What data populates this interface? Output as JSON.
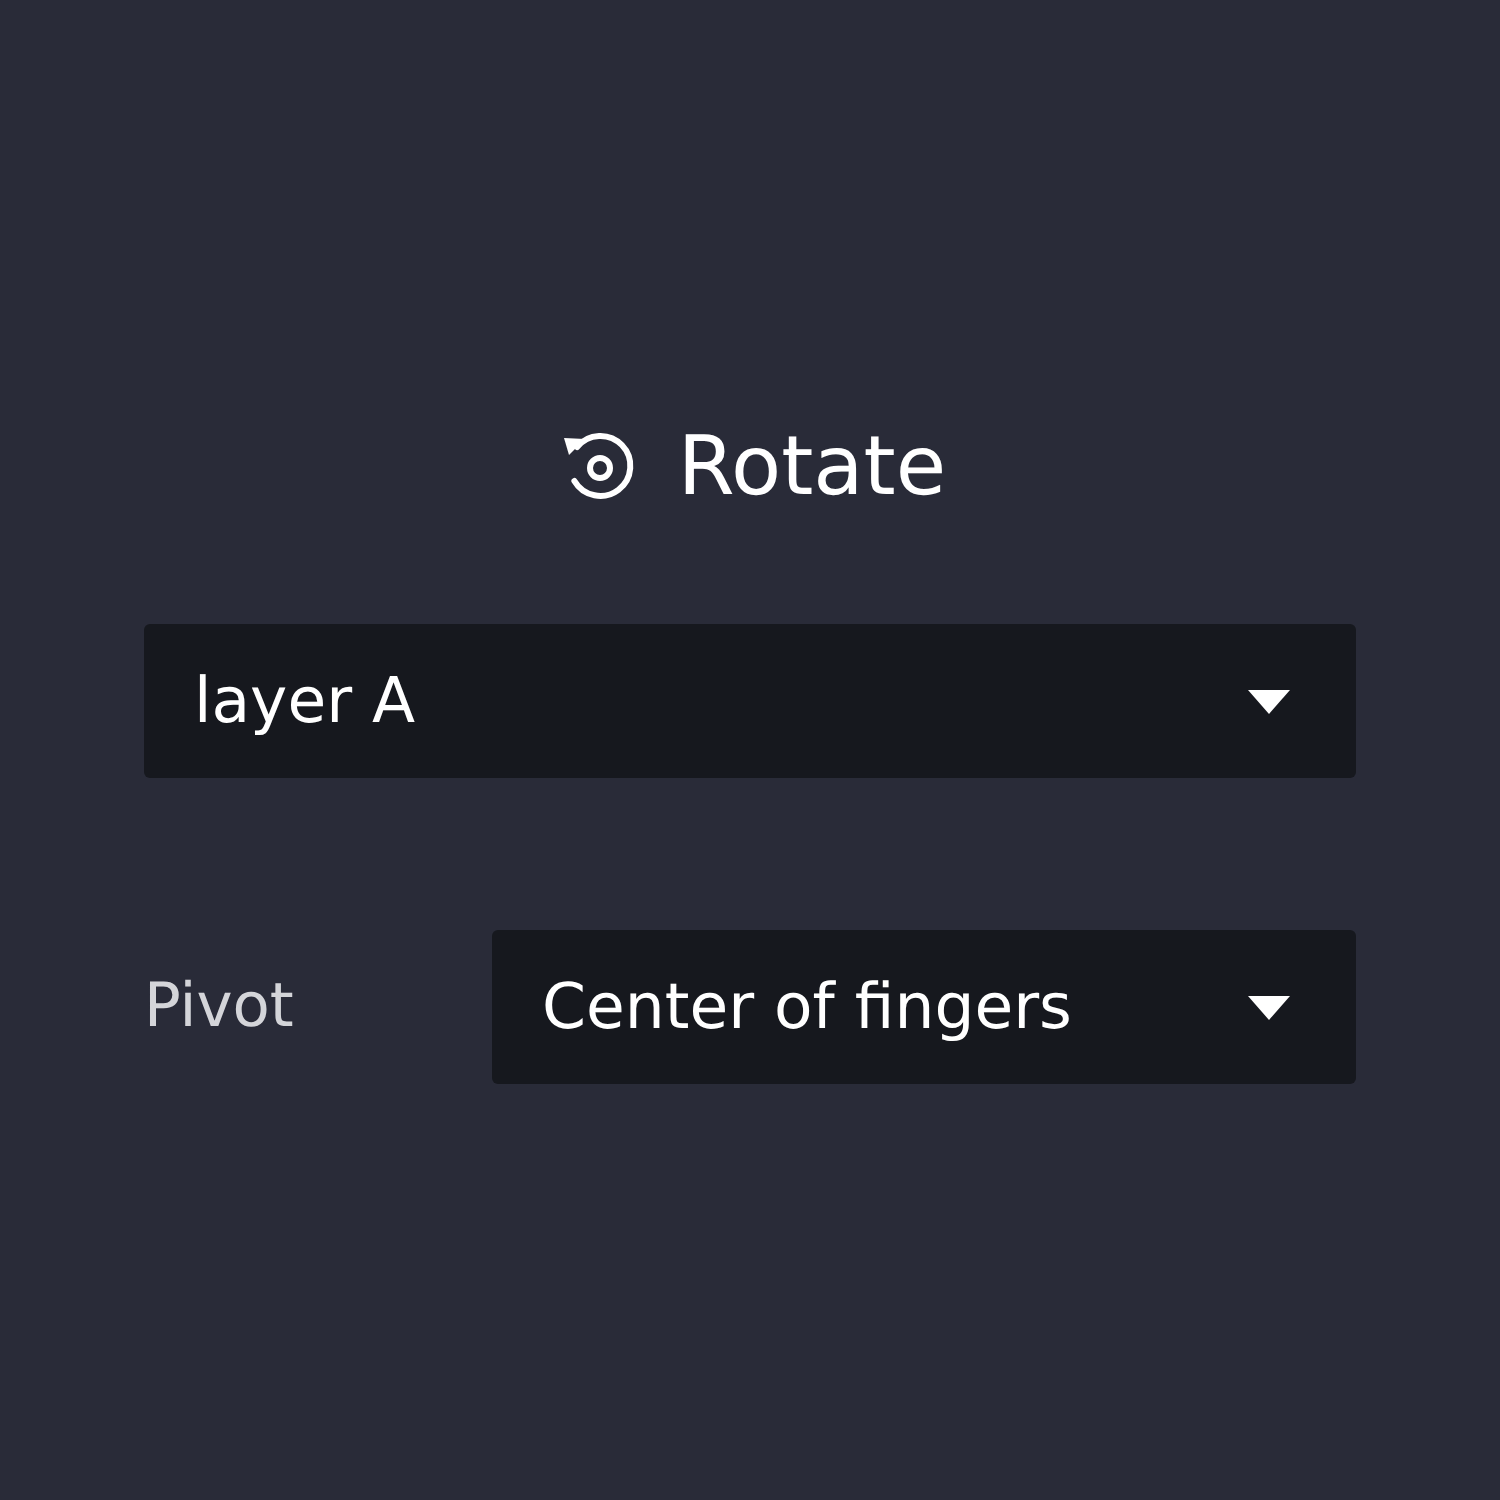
{
  "title": {
    "text": "Rotate"
  },
  "layer_dropdown": {
    "value": "layer A"
  },
  "pivot": {
    "label": "Pivot",
    "value": "Center of fingers"
  }
}
